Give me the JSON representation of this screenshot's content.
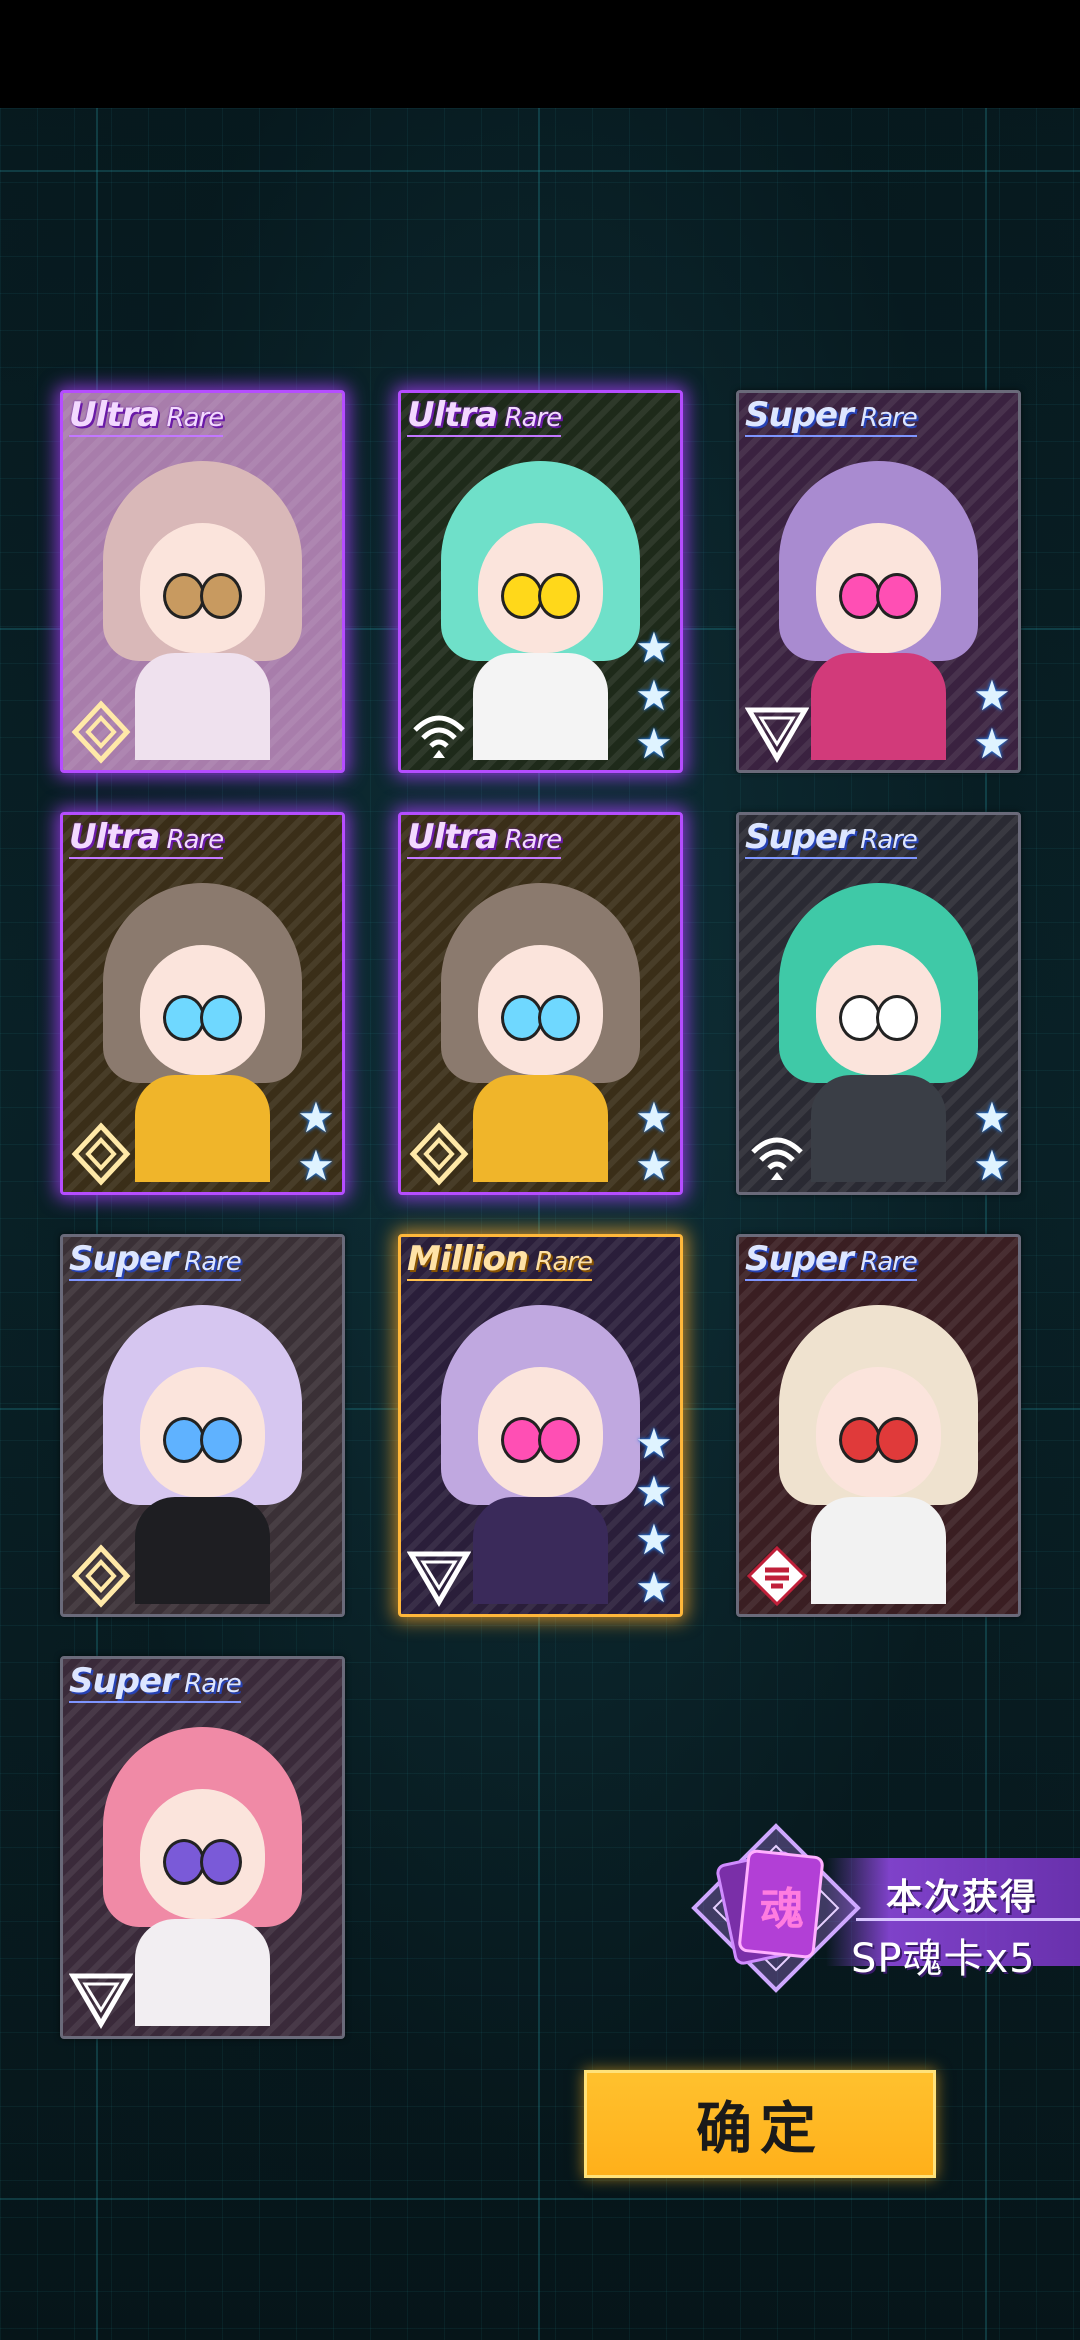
{
  "colors": {
    "ultra_rare_frame": "#b54dff",
    "million_rare_frame": "#ffb73a",
    "super_rare_frame": "#6a6a7a",
    "confirm_button": "#ffb01a",
    "reward_band": "#8c46dc",
    "star": "#dff3ff"
  },
  "cards": [
    {
      "rarity_main": "Ultra",
      "rarity_sub": "Rare",
      "tier": "ur",
      "type_icon": "diamond-icon",
      "stars": 0,
      "hair": "#d9b8b8",
      "body": "#efe1ee",
      "eye": "#c89a60",
      "bg": "#a87dab"
    },
    {
      "rarity_main": "Ultra",
      "rarity_sub": "Rare",
      "tier": "ur",
      "type_icon": "signal-icon",
      "stars": 3,
      "hair": "#6fe0c9",
      "body": "#f4f4f4",
      "eye": "#ffd81a",
      "bg": "#1e2a1a"
    },
    {
      "rarity_main": "Super",
      "rarity_sub": "Rare",
      "tier": "sr",
      "type_icon": "triangle-icon",
      "stars": 2,
      "hair": "#a98bd0",
      "body": "#d23a7a",
      "eye": "#ff4fb4",
      "bg": "#3a2240"
    },
    {
      "rarity_main": "Ultra",
      "rarity_sub": "Rare",
      "tier": "ur",
      "type_icon": "diamond-icon",
      "stars": 2,
      "hair": "#8b7a6e",
      "body": "#f0b52a",
      "eye": "#6fd8ff",
      "bg": "#3a2e18"
    },
    {
      "rarity_main": "Ultra",
      "rarity_sub": "Rare",
      "tier": "ur",
      "type_icon": "diamond-icon",
      "stars": 2,
      "hair": "#8b7a6e",
      "body": "#f0b52a",
      "eye": "#6fd8ff",
      "bg": "#3a2e18"
    },
    {
      "rarity_main": "Super",
      "rarity_sub": "Rare",
      "tier": "sr",
      "type_icon": "signal-icon",
      "stars": 2,
      "hair": "#3fc9a7",
      "body": "#3a3e46",
      "eye": "#ffffff",
      "bg": "#2a2a33"
    },
    {
      "rarity_main": "Super",
      "rarity_sub": "Rare",
      "tier": "sr",
      "type_icon": "diamond-icon",
      "stars": 0,
      "hair": "#d6c6f0",
      "body": "#1e1e22",
      "eye": "#5fb2ff",
      "bg": "#3a3036"
    },
    {
      "rarity_main": "Million",
      "rarity_sub": "Rare",
      "tier": "mr",
      "type_icon": "triangle-icon",
      "stars": 4,
      "hair": "#c0a8e0",
      "body": "#3a2a5a",
      "eye": "#ff4fb4",
      "bg": "#2a1e3a"
    },
    {
      "rarity_main": "Super",
      "rarity_sub": "Rare",
      "tier": "sr",
      "type_icon": "skull-icon",
      "stars": 0,
      "hair": "#efe2cf",
      "body": "#f2f2f2",
      "eye": "#e03a3a",
      "bg": "#3a1e22"
    },
    {
      "rarity_main": "Super",
      "rarity_sub": "Rare",
      "tier": "sr",
      "type_icon": "triangle-icon",
      "stars": 0,
      "hair": "#f08aa6",
      "body": "#f2eef2",
      "eye": "#7a5ad8",
      "bg": "#3a2a3a"
    }
  ],
  "reward": {
    "title": "本次获得",
    "value": "SP魂卡x5",
    "icon_glyph": "魂"
  },
  "confirm": {
    "label": "确定"
  }
}
